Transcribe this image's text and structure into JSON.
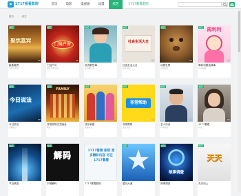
{
  "app": {
    "logo_text": "1717看看影院",
    "brand_color": "#1a9fd9",
    "accent": "#27b57a"
  },
  "nav": {
    "items": [
      {
        "label": "首页",
        "active": false
      },
      {
        "label": "电影",
        "active": false
      },
      {
        "label": "电视剧",
        "active": false
      },
      {
        "label": "动漫",
        "active": false
      },
      {
        "label": "综艺",
        "active": true
      },
      {
        "label": "1717看看影院",
        "active": false
      }
    ]
  },
  "header": {
    "search_placeholder": "",
    "search_icon": "search-icon",
    "user_icon": "user-icon"
  },
  "breadcrumb": {
    "items": [
      "首页",
      "综艺"
    ]
  },
  "cards": [
    {
      "tag": "综艺",
      "duration": "HD",
      "title": "聚焦嘉宾",
      "meta": "主持人访谈",
      "image_caption": "聚焦嘉宾"
    },
    {
      "tag": "综艺",
      "duration": "HD",
      "title": "门当户对",
      "meta": "相亲交友节目",
      "image_caption": "门当户对"
    },
    {
      "tag": "综艺",
      "duration": "HD",
      "title": "说说那些事",
      "meta": "生活脱口秀",
      "image_caption": ""
    },
    {
      "tag": "综艺",
      "duration": "HD",
      "title": "社会生活大全",
      "meta": "纪实节目",
      "image_caption": "社会生活大全"
    },
    {
      "tag": "综艺",
      "duration": "HD",
      "title": "动物世界",
      "meta": "自然纪录",
      "image_caption": ""
    },
    {
      "tag": "综艺",
      "duration": "HD",
      "title": "周利利童话故事",
      "meta": "少儿动画",
      "image_caption": "周利利"
    },
    {
      "tag": "综艺",
      "duration": "HD",
      "title": "今日说法",
      "meta": "法制栏目",
      "image_caption": "今日说法"
    },
    {
      "tag": "综艺",
      "duration": "HD",
      "title": "非常现场文艺晚会",
      "meta": "晚会",
      "image_caption": "FAMILY"
    },
    {
      "tag": "综艺",
      "duration": "HD",
      "title": "快乐家庭",
      "meta": "家庭综艺",
      "image_caption": ""
    },
    {
      "tag": "综艺",
      "duration": "HD",
      "title": "非常帮助",
      "meta": "民生节目",
      "image_caption": "非常帮助"
    },
    {
      "tag": "综艺",
      "duration": "HD",
      "title": "名人访谈",
      "meta": "人物访谈",
      "image_caption": ""
    },
    {
      "tag": "综艺",
      "duration": "HD",
      "title": "1717看看",
      "meta": "片花",
      "image_caption": ""
    },
    {
      "tag": "综艺",
      "duration": "HD",
      "title": "节目精选",
      "meta": "",
      "image_caption": ""
    },
    {
      "tag": "综艺",
      "duration": "HD",
      "title": "字幕解码",
      "meta": "",
      "image_caption": "解码"
    },
    {
      "tag": "",
      "duration": "",
      "title": "1717看看影院",
      "meta": "",
      "image_caption": "1717看看 影院 更多精彩内容 尽在1717看看"
    },
    {
      "tag": "综艺",
      "duration": "HD",
      "title": "星光大道",
      "meta": "",
      "image_caption": ""
    },
    {
      "tag": "综艺",
      "duration": "HD",
      "title": "故事调查",
      "meta": "",
      "image_caption": "故事调查"
    },
    {
      "tag": "综艺",
      "duration": "HD",
      "title": "天天向上",
      "meta": "",
      "image_caption": "天天"
    }
  ]
}
